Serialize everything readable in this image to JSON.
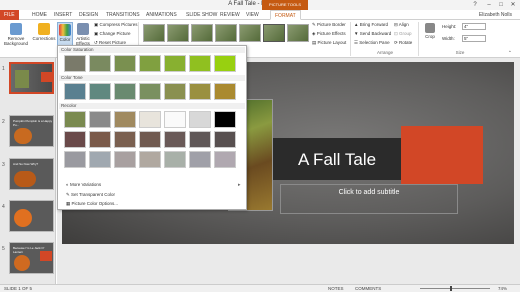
{
  "app": {
    "title": "A Fall Tale - PowerPoint",
    "context_tab": "PICTURE TOOLS",
    "user": "Elizabeth Nolls"
  },
  "tabs": [
    "FILE",
    "HOME",
    "INSERT",
    "DESIGN",
    "TRANSITIONS",
    "ANIMATIONS",
    "SLIDE SHOW",
    "REVIEW",
    "VIEW",
    "FORMAT"
  ],
  "ribbon": {
    "remove_background": "Remove Background",
    "corrections": "Corrections",
    "color": "Color",
    "artistic_effects": "Artistic Effects",
    "compress": "Compress Pictures",
    "change": "Change Picture",
    "reset": "Reset Picture",
    "picture_border": "Picture Border",
    "picture_effects": "Picture Effects",
    "picture_layout": "Picture Layout",
    "bring_forward": "Bring Forward",
    "send_backward": "Send Backward",
    "selection_pane": "Selection Pane",
    "align": "Align",
    "group": "Group",
    "rotate": "Rotate",
    "crop": "Crop",
    "height_label": "Height:",
    "height_value": "4\"",
    "width_label": "Width:",
    "width_value": "5\"",
    "arrange_group": "Arrange",
    "size_group": "Size"
  },
  "gallery": {
    "saturation_header": "Color Saturation",
    "tone_header": "Color Tone",
    "recolor_header": "Recolor",
    "more_variations": "More Variations",
    "set_transparent": "Set Transparent Color",
    "color_options": "Picture Color Options..."
  },
  "slides": [
    {
      "num": "1",
      "caption": ""
    },
    {
      "num": "2",
      "caption": "Pumpkin Pumpkin is a Happy Pu..."
    },
    {
      "num": "3",
      "caption": "And So Now Why?"
    },
    {
      "num": "4",
      "caption": ""
    },
    {
      "num": "5",
      "caption": "Because I'm Le Jack O' Lantern"
    }
  ],
  "slide": {
    "title": "A Fall Tale",
    "subtitle": "Click to add subtitle"
  },
  "status": {
    "slide_info": "SLIDE 1 OF 5",
    "notes": "NOTES",
    "comments": "COMMENTS",
    "zoom": "74%"
  },
  "colors": {
    "accent": "#d24726",
    "dark_bar": "#2b2b2b"
  }
}
